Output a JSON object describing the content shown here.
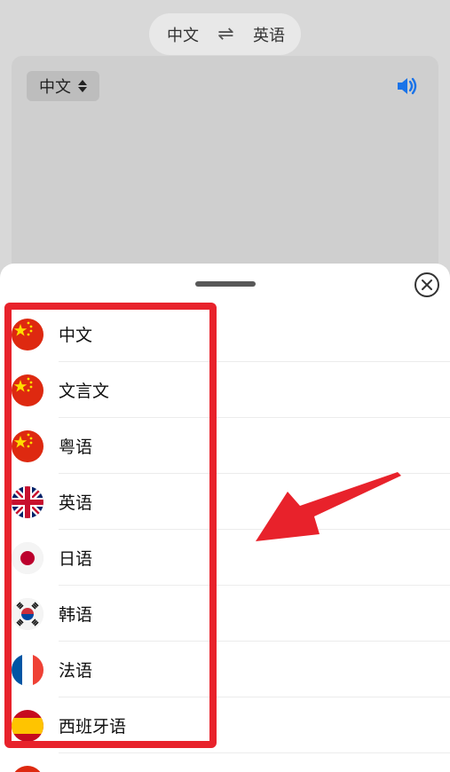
{
  "header": {
    "source_lang": "中文",
    "target_lang": "英语",
    "swap_icon": "⇌"
  },
  "input_panel": {
    "source_select": "中文"
  },
  "sheet": {
    "languages": [
      {
        "label": "中文",
        "flag": "china"
      },
      {
        "label": "文言文",
        "flag": "china"
      },
      {
        "label": "粤语",
        "flag": "china"
      },
      {
        "label": "英语",
        "flag": "uk"
      },
      {
        "label": "日语",
        "flag": "japan"
      },
      {
        "label": "韩语",
        "flag": "korea"
      },
      {
        "label": "法语",
        "flag": "france"
      },
      {
        "label": "西班牙语",
        "flag": "spain"
      }
    ]
  },
  "colors": {
    "highlight": "#e8222b",
    "accent": "#1a73e8"
  }
}
